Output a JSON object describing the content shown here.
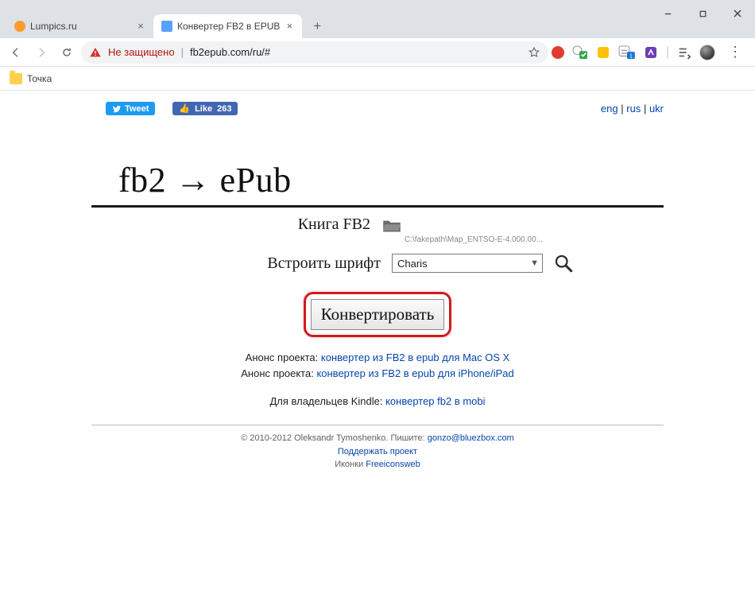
{
  "browser": {
    "tabs": [
      {
        "title": "Lumpics.ru",
        "favicon": "orange-dot",
        "active": false
      },
      {
        "title": "Конвертер FB2 в EPUB",
        "favicon": "doc",
        "active": true
      }
    ],
    "security_warning": "Не защищено",
    "url": "fb2epub.com/ru/#",
    "bookmark_folder": "Точка"
  },
  "socials": {
    "tweet_label": "Tweet",
    "fb_like_label": "Like",
    "fb_like_count": "263"
  },
  "langs": {
    "eng": "eng",
    "rus": "rus",
    "ukr": "ukr"
  },
  "heading": "fb2 → ePub",
  "form": {
    "book_label": "Книга FB2",
    "file_path": "C:\\fakepath\\Map_ENTSO-E-4.000.00...",
    "font_label": "Встроить шрифт",
    "font_value": "Charis",
    "convert_label": "Конвертировать"
  },
  "annos": {
    "prefix": "Анонс проекта: ",
    "mac_link": "конвертер из FB2 в epub для Mac OS X",
    "ios_link": "конвертер из FB2 в epub для iPhone/iPad"
  },
  "kindle": {
    "prefix": "Для владельцев Kindle: ",
    "link": "конвертер fb2 в mobi"
  },
  "footer": {
    "copyright": "© 2010-2012 Oleksandr Tymoshenko. Пишите: ",
    "email": "gonzo@bluezbox.com",
    "support_link": "Поддержать проект",
    "icons_prefix": "Иконки ",
    "icons_link": "Freeiconsweb"
  }
}
